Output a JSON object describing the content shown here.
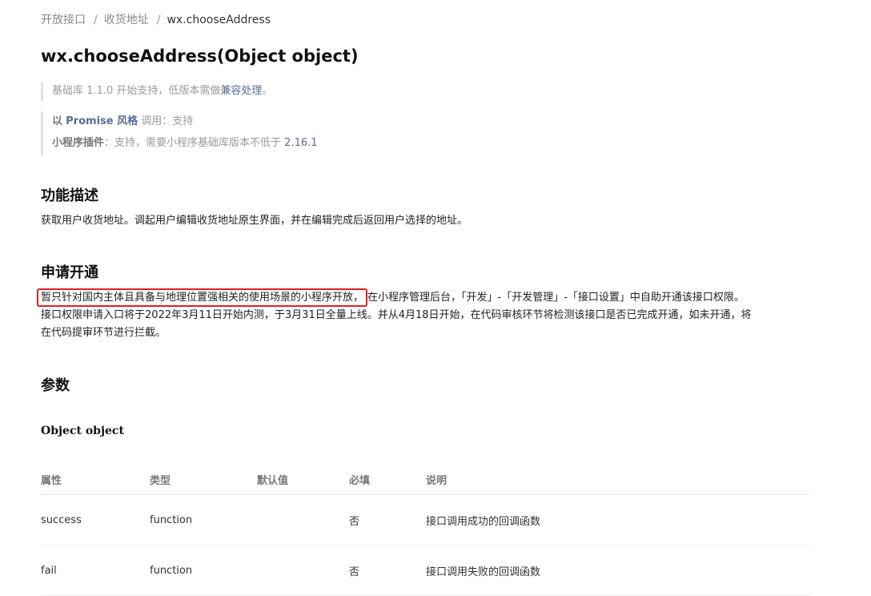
{
  "breadcrumb": [
    "开放接口",
    "收货地址",
    "wx.chooseAddress"
  ],
  "title": "wx.chooseAddress(Object object)",
  "support": {
    "base_prefix": "基础库 1.1.0 开始支持，低版本需做",
    "compat_link": "兼容处理",
    "base_suffix": "。",
    "promise_prefix": "以",
    "promise_link": "Promise 风格",
    "promise_suffix": "调用：支持",
    "plugin_label": "小程序插件",
    "plugin_text": "：支持，需要小程序基础库版本不低于",
    "plugin_version": "2.16.1"
  },
  "section_description": {
    "heading": "功能描述",
    "text": "获取用户收货地址。调起用户编辑收货地址原生界面，并在编辑完成后返回用户选择的地址。"
  },
  "section_apply": {
    "heading": "申请开通",
    "highlight": "暂只针对国内主体且具备与地理位置强相关的使用场景的小程序开放，",
    "line1_rest": "在小程序管理后台，「开发」-「开发管理」-「接口设置」中自助开通该接口权限。",
    "line2": "接口权限申请入口将于2022年3月11日开始内测，于3月31日全量上线。并从4月18日开始，在代码审核环节将检测该接口是否已完成开通，如未开通，将",
    "line3": "在代码提审环节进行拦截。"
  },
  "section_params": {
    "heading": "参数",
    "object_title": "Object object"
  },
  "table": {
    "headers": [
      "属性",
      "类型",
      "默认值",
      "必填",
      "说明"
    ],
    "rows": [
      [
        "success",
        "function",
        "",
        "否",
        "接口调用成功的回调函数"
      ],
      [
        "fail",
        "function",
        "",
        "否",
        "接口调用失败的回调函数"
      ]
    ]
  }
}
